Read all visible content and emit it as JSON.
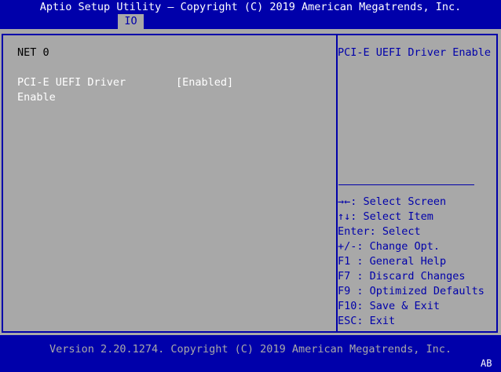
{
  "header": {
    "title": "Aptio Setup Utility – Copyright (C) 2019 American Megatrends, Inc.",
    "tab": "IO"
  },
  "left_panel": {
    "section": "NET 0",
    "settings": [
      {
        "label_line1": "PCI-E UEFI Driver",
        "label_line2": "Enable",
        "value": "[Enabled]"
      }
    ]
  },
  "help_panel": {
    "description": "PCI-E UEFI Driver Enable",
    "keys": [
      "→←: Select Screen",
      "↑↓: Select Item",
      "Enter: Select",
      "+/-: Change Opt.",
      "F1 : General Help",
      "F7 : Discard Changes",
      "F9 : Optimized Defaults",
      "F10: Save & Exit",
      "ESC: Exit"
    ]
  },
  "footer": {
    "version": "Version 2.20.1274. Copyright (C) 2019 American Megatrends, Inc.",
    "corner": "AB"
  },
  "colors": {
    "background": "#0000aa",
    "panel": "#a8a8a8",
    "text_white": "#ffffff",
    "text_black": "#000000",
    "text_blue": "#0000aa"
  }
}
